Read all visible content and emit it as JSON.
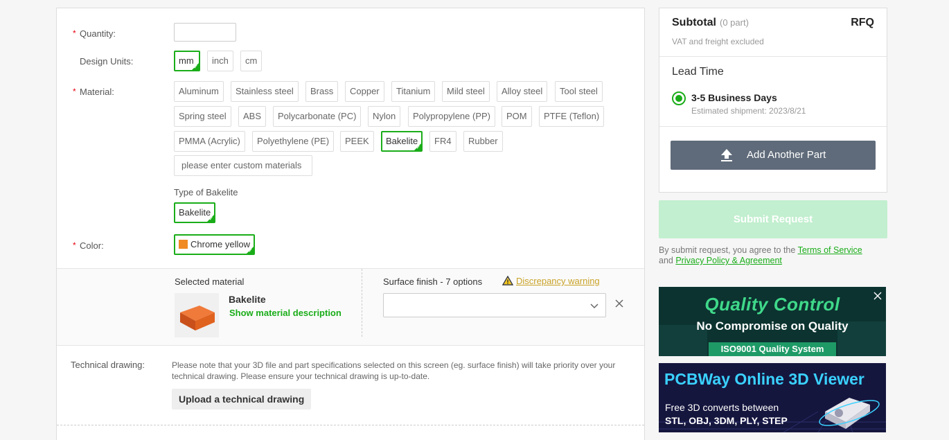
{
  "form": {
    "quantity": {
      "label": "Quantity:",
      "value": ""
    },
    "units": {
      "label": "Design Units:",
      "options": [
        "mm",
        "inch",
        "cm"
      ],
      "selected": "mm"
    },
    "material": {
      "label": "Material:",
      "options": [
        "Aluminum",
        "Stainless steel",
        "Brass",
        "Copper",
        "Titanium",
        "Mild steel",
        "Alloy steel",
        "Tool steel",
        "Spring steel",
        "ABS",
        "Polycarbonate (PC)",
        "Nylon",
        "Polypropylene (PP)",
        "POM",
        "PTFE (Teflon)",
        "PMMA (Acrylic)",
        "Polyethylene (PE)",
        "PEEK",
        "Bakelite",
        "FR4",
        "Rubber"
      ],
      "selected": "Bakelite",
      "custom_placeholder": "please enter custom materials"
    },
    "type": {
      "label": "Type of Bakelite",
      "selected": "Bakelite"
    },
    "color": {
      "label": "Color:",
      "selected": "Chrome yellow",
      "swatch": "#f08a24"
    },
    "required_mark": "*"
  },
  "selected_material": {
    "title": "Selected material",
    "name": "Bakelite",
    "description_link": "Show material description"
  },
  "surface_finish": {
    "label": "Surface finish - 7 options",
    "warning": "Discrepancy warning",
    "value": ""
  },
  "technical_drawing": {
    "label": "Technical drawing:",
    "note": "Please note that your 3D file and part specifications selected on this screen (eg. surface finish) will take priority over your technical drawing. Please ensure your technical drawing is up-to-date.",
    "upload_label": "Upload a technical drawing"
  },
  "summary": {
    "subtotal_label": "Subtotal",
    "part_count": "(0 part)",
    "price": "RFQ",
    "vat_note": "VAT and freight excluded",
    "lead_time_title": "Lead Time",
    "lead_option": "3-5 Business Days",
    "estimated_shipment": "Estimated shipment: 2023/8/21",
    "add_part_label": "Add Another Part"
  },
  "submit": {
    "label": "Submit Request",
    "agree_prefix": "By submit request, you agree to the ",
    "terms_link": "Terms of Service",
    "and_text": "and ",
    "privacy_link": "Privacy Policy & Agreement"
  },
  "banners": {
    "quality": {
      "title": "Quality Control",
      "subtitle": "No Compromise on Quality",
      "badge": "ISO9001 Quality System"
    },
    "viewer": {
      "title": "PCBWay Online 3D Viewer",
      "line1": "Free 3D converts between",
      "line2": "STL, OBJ, 3DM, PLY, STEP"
    }
  },
  "colors": {
    "accent": "#1aad19",
    "warning": "#c9a227",
    "button_dark": "#5f6b7a",
    "submit_disabled": "#c2efcf",
    "required": "#e60012"
  }
}
